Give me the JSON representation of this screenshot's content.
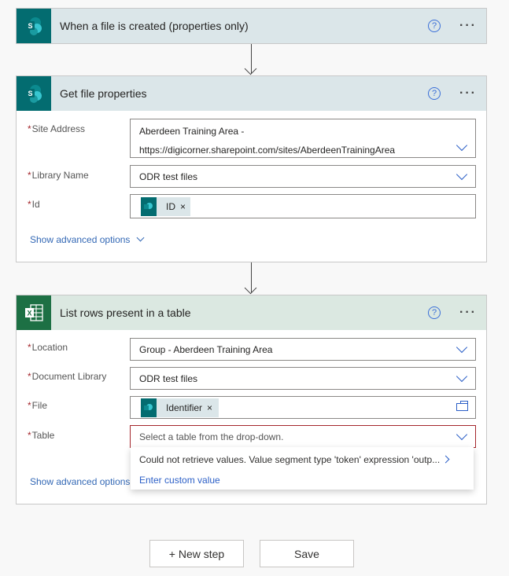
{
  "steps": [
    {
      "title": "When a file is created (properties only)",
      "app": "SharePoint",
      "app_color": "#036c70",
      "header_color": "#dbe6e9"
    },
    {
      "title": "Get file properties",
      "app": "SharePoint",
      "fields": [
        {
          "label": "Site Address",
          "required": true,
          "value_line1": "Aberdeen Training Area -",
          "value_line2": "https://digicorner.sharepoint.com/sites/AberdeenTrainingArea"
        },
        {
          "label": "Library Name",
          "required": true,
          "value": "ODR test files"
        },
        {
          "label": "Id",
          "required": true,
          "token": "ID"
        }
      ],
      "advanced_label": "Show advanced options"
    },
    {
      "title": "List rows present in a table",
      "app": "Excel Online",
      "app_color": "#1d7044",
      "header_color": "#dbe8e1",
      "fields": [
        {
          "label": "Location",
          "required": true,
          "value": "Group - Aberdeen Training Area"
        },
        {
          "label": "Document Library",
          "required": true,
          "value": "ODR test files"
        },
        {
          "label": "File",
          "required": true,
          "token": "Identifier"
        },
        {
          "label": "Table",
          "required": true,
          "placeholder": "Select a table from the drop-down."
        }
      ],
      "advanced_label": "Show advanced options",
      "dropdown": {
        "error_message": "Could not retrieve values. Value segment type 'token' expression 'outp...",
        "custom_value_label": "Enter custom value"
      }
    }
  ],
  "icons": {
    "help": "?",
    "more": "···",
    "required_marker": "*",
    "token_remove": "×"
  },
  "footer": {
    "new_step_label": "+ New step",
    "save_label": "Save"
  },
  "colors": {
    "error_border": "#a4262c",
    "link": "#3368b5"
  }
}
